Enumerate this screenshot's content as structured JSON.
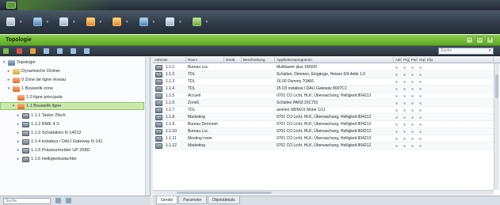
{
  "window": {
    "title": ""
  },
  "ribbon": {
    "buttons": [
      {
        "label": "",
        "icon": "new-icon"
      },
      {
        "label": "",
        "icon": "import-icon"
      },
      {
        "label": "",
        "icon": "print-icon"
      },
      {
        "label": "",
        "icon": "tools-icon"
      },
      {
        "label": "",
        "icon": "diagnostics-icon"
      },
      {
        "label": "",
        "icon": "workspace-icon"
      },
      {
        "label": "",
        "icon": "settings-icon"
      },
      {
        "label": "",
        "icon": "help-icon"
      }
    ]
  },
  "panel": {
    "title": "Topologie"
  },
  "toolbar": {
    "items": [
      "",
      "",
      "",
      "",
      "",
      "",
      ""
    ],
    "search_placeholder": "Suche"
  },
  "tree": {
    "nodes": [
      {
        "label": "Topologie",
        "level": 0,
        "icon": "building"
      },
      {
        "label": "Dynamische Ordner",
        "level": 1,
        "icon": "folder"
      },
      {
        "label": "0 Zone de ligne réseau",
        "level": 1,
        "icon": "floor"
      },
      {
        "label": "1 Bouwelik zone",
        "level": 1,
        "icon": "floor"
      },
      {
        "label": "1.0 ligne principale",
        "level": 2,
        "icon": "floor"
      },
      {
        "label": "1.1 Bouwelik ligne",
        "level": 2,
        "icon": "floor",
        "selected": true
      },
      {
        "label": "1.1.1 Taster 2fach",
        "level": 3,
        "icon": "device"
      },
      {
        "label": "1.1.2 RME 4 S",
        "level": 3,
        "icon": "device"
      },
      {
        "label": "1.1.3 Schaltaktor N 14012",
        "level": 3,
        "icon": "device"
      },
      {
        "label": "1.1.4 instabus / DALI Gateway N 141",
        "level": 3,
        "icon": "device"
      },
      {
        "label": "1.1.5 Präsenzmelder UP 258D",
        "level": 3,
        "icon": "device"
      },
      {
        "label": "1.1.6 Helligkeitswächter",
        "level": 3,
        "icon": "device"
      }
    ],
    "search_placeholder": "Suche"
  },
  "grid": {
    "columns": [
      "Adresse",
      "Raum",
      "Gerät",
      "Beschreibung",
      "Applikationsprogramm",
      "Adr",
      "Prg",
      "Par",
      "Grp",
      "Kfg"
    ],
    "rows": [
      {
        "address": "1.1.1",
        "room": "Bureau Luc",
        "app": "Multitaster plus 1MS00"
      },
      {
        "address": "1.1.2",
        "room": "TDL",
        "app": "Schalten, Dimmen, Eingänge, Heizen 5/4.4elte 1.0"
      },
      {
        "address": "1.1.3",
        "room": "TDL",
        "app": "16.00 Dummy 70A66"
      },
      {
        "address": "1.1.4",
        "room": "TDL",
        "app": "25 D3 instabus / DALI Gateway 8007C1"
      },
      {
        "address": "1.1.5",
        "room": "Accueil",
        "app": "0701 CO Licht, HLK, Überwachung, Helligkeit 804212"
      },
      {
        "address": "1.1.6",
        "room": "Zone5",
        "app": "Schalten PAN3 20C701"
      },
      {
        "address": "1.1.7",
        "room": "TDL",
        "app": "animeo SB/MXX Motor 1/11"
      },
      {
        "address": "1.1.8",
        "room": "Marketing",
        "app": "0701 CO Licht, HLK, Überwachung, Helligkeit 804212"
      },
      {
        "address": "1.1.9",
        "room": "Bureau Demonet",
        "app": "0701 CO Licht, HLK, Überwachung, Helligkeit 804212"
      },
      {
        "address": "1.1.10",
        "room": "Bureau Luc",
        "app": "0701 CO Licht, HLK, Überwachung, Helligkeit 804212"
      },
      {
        "address": "1.1.11",
        "room": "Meeting room",
        "app": "0701 CO Licht, HLK, Überwachung, Helligkeit 804212"
      },
      {
        "address": "1.1.12",
        "room": "Marketing",
        "app": "0701 CO Licht, HLK, Überwachung, Helligkeit 804212"
      }
    ]
  },
  "tabs": [
    "Geräte",
    "Parameter",
    "Objektdetails"
  ],
  "colors": {
    "accent": "#6fb832",
    "chrome": "#2e3945"
  }
}
